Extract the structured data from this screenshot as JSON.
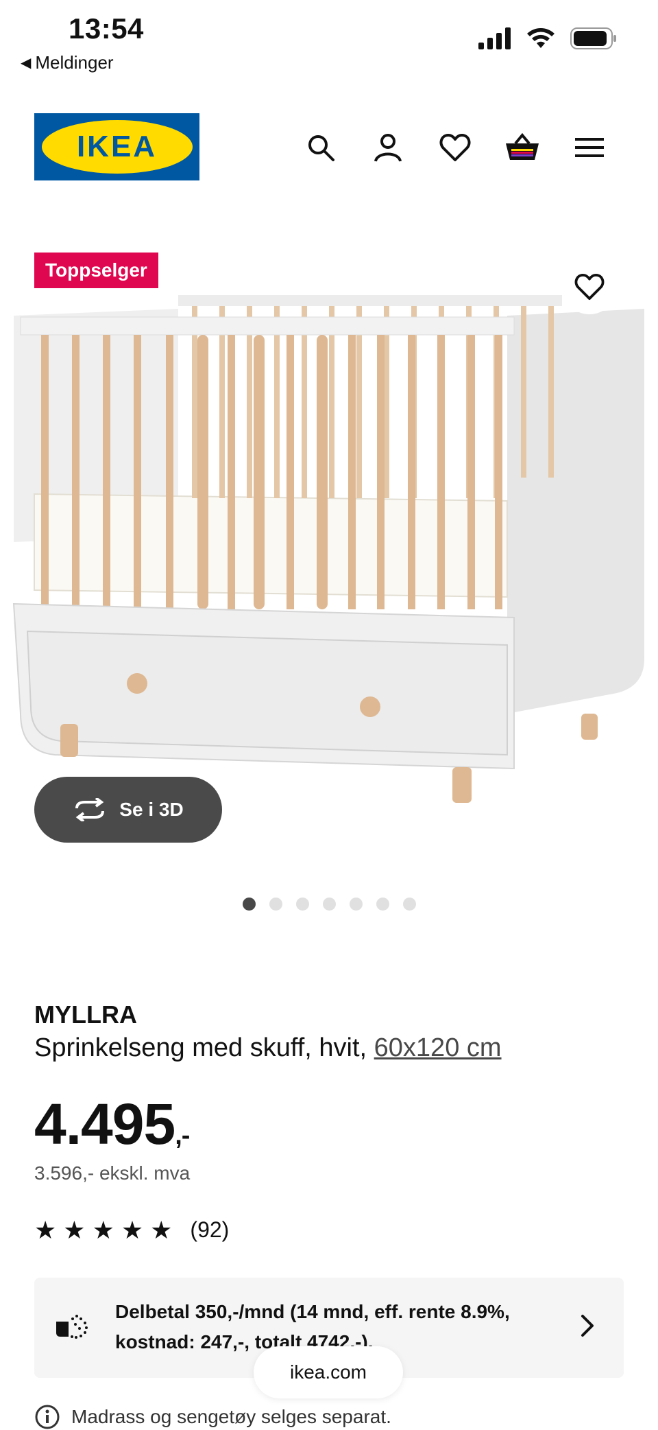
{
  "status_bar": {
    "time": "13:54",
    "back_label": "Meldinger"
  },
  "header": {
    "logo_text": "IKEA",
    "icons": [
      "search-icon",
      "user-icon",
      "heart-icon",
      "basket-icon",
      "menu-icon"
    ]
  },
  "product": {
    "badge": "Toppselger",
    "view_3d_label": "Se i 3D",
    "carousel_count": 7,
    "carousel_active": 1,
    "name": "MYLLRA",
    "description": "Sprinkelseng med skuff, hvit,",
    "dimension_link": "60x120 cm",
    "price_main": "4.495",
    "price_suffix": ",-",
    "price_ex_vat": "3.596,- ekskl. mva",
    "rating": 5,
    "review_count": "(92)",
    "financing_text": "Delbetal 350,-/mnd (14 mnd, eff. rente 8.9%, kostnad: 247,-, totalt 4742,-).",
    "notice": "Madrass og sengetøy selges separat."
  },
  "browser": {
    "url": "ikea.com"
  },
  "colors": {
    "ikea_blue": "#0058a3",
    "ikea_yellow": "#ffdb00",
    "badge_red": "#e00751",
    "button_dark": "#4a4a4a"
  }
}
